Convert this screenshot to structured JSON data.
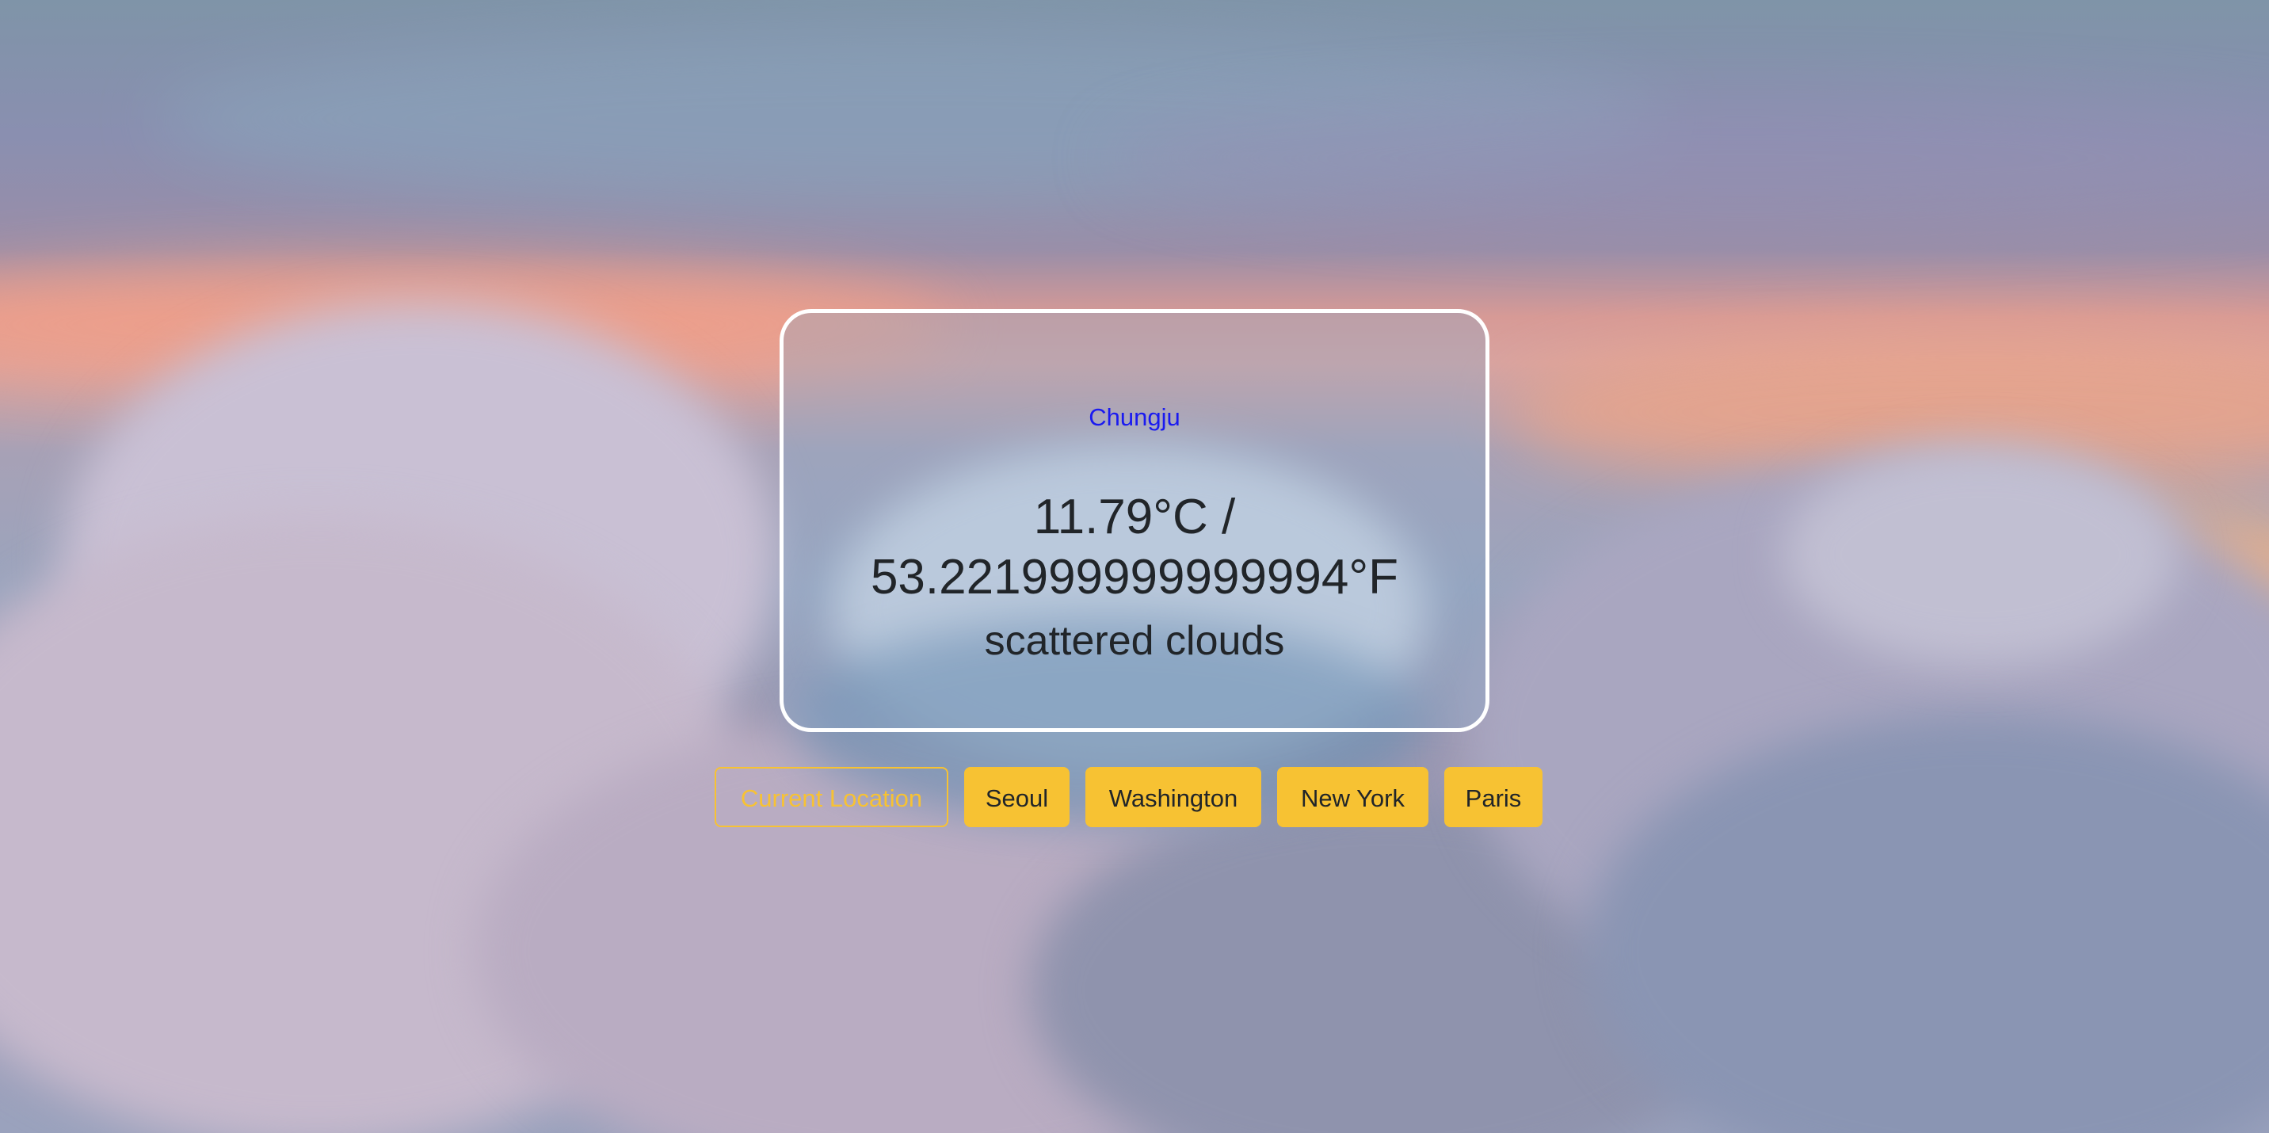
{
  "weather": {
    "city": "Chungju",
    "temperature": "11.79°C / 53.221999999999994°F",
    "description": "scattered clouds"
  },
  "locations": [
    {
      "label": "Current Location",
      "style": "outline"
    },
    {
      "label": "Seoul",
      "style": "solid"
    },
    {
      "label": "Washington",
      "style": "solid"
    },
    {
      "label": "New York",
      "style": "solid"
    },
    {
      "label": "Paris",
      "style": "solid"
    }
  ],
  "colors": {
    "accent": "#f7c233",
    "city_text": "#1a1af0",
    "text": "#212529",
    "card_border": "#ffffff"
  }
}
